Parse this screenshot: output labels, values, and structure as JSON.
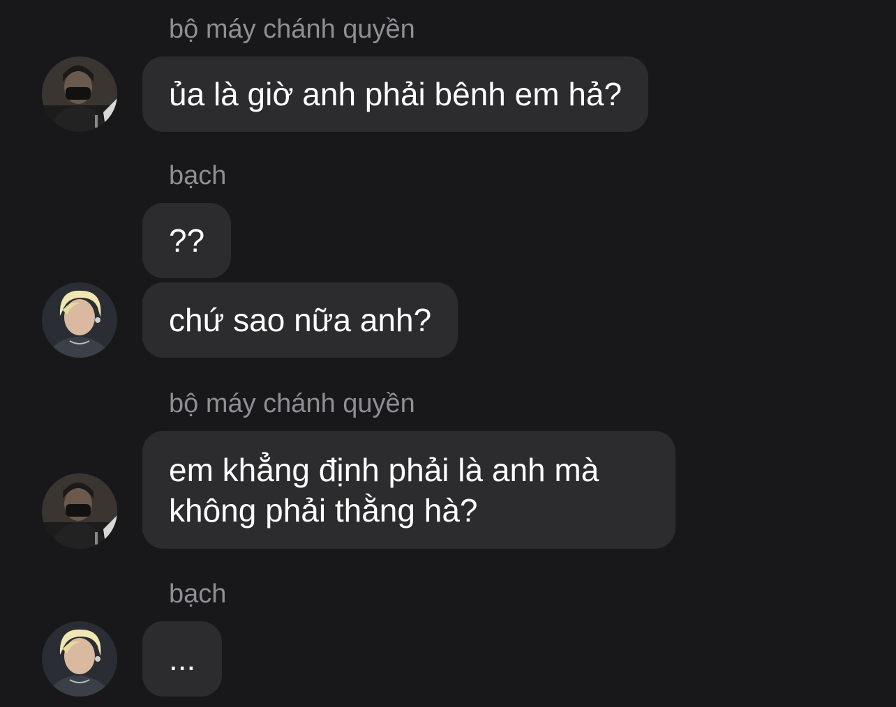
{
  "conversation": {
    "messages": [
      {
        "sender": "bộ máy chánh quyền",
        "text": "ủa là giờ anh phải bênh em hả?"
      },
      {
        "sender": "bạch",
        "text": "??"
      },
      {
        "sender": "",
        "text": "chứ sao nữa anh?"
      },
      {
        "sender": "bộ máy chánh quyền",
        "text_lines": [
          "em khẳng định phải là anh mà",
          "không phải thằng hà?"
        ]
      },
      {
        "sender": "bạch",
        "text": "..."
      }
    ]
  },
  "colors": {
    "background": "#18181a",
    "bubble": "#2c2c2e",
    "sender_name": "#8e8e93",
    "message_text": "#ffffff"
  },
  "icons": {
    "avatar_1": "masked-person-avatar",
    "avatar_2": "blonde-person-avatar"
  }
}
